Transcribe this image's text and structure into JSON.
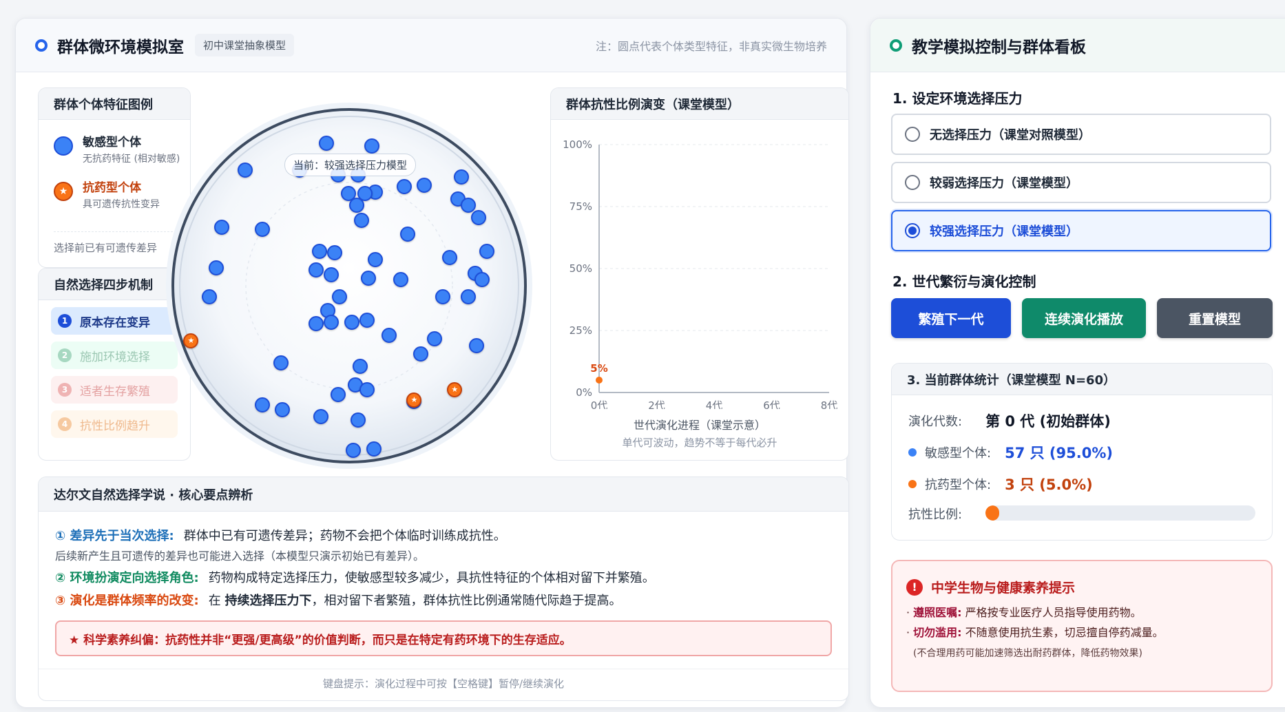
{
  "left": {
    "title": "群体微环境模拟室",
    "tag": "初中课堂抽象模型",
    "note": "注：圆点代表个体类型特征，非真实微生物培养"
  },
  "legend": {
    "header": "群体个体特征图例",
    "sensitive_name": "敏感型个体",
    "sensitive_desc": "无抗药特征 (相对敏感)",
    "resistant_name": "抗药型个体",
    "resistant_desc": "具可遗传抗性变异",
    "footer": "选择前已有可遗传差异"
  },
  "steps": {
    "header": "自然选择四步机制",
    "items": [
      {
        "num": "1",
        "label": "原本存在变异"
      },
      {
        "num": "2",
        "label": "施加环境选择"
      },
      {
        "num": "3",
        "label": "适者生存繁殖"
      },
      {
        "num": "4",
        "label": "抗性比例趋升"
      }
    ]
  },
  "dish": {
    "current_label": "当前：较强选择压力模型"
  },
  "chart_header": "群体抗性比例演变（课堂模型）",
  "chart_data": {
    "type": "line",
    "title": "群体抗性比例演变（课堂模型）",
    "x": [
      0
    ],
    "series": [
      {
        "values": [
          5
        ]
      }
    ],
    "x_ticks": [
      "0代",
      "2代",
      "4代",
      "6代",
      "8代"
    ],
    "x_tick_values": [
      0,
      2,
      4,
      6,
      8
    ],
    "y_ticks": [
      "0%",
      "25%",
      "50%",
      "75%",
      "100%"
    ],
    "y_tick_values": [
      0,
      25,
      50,
      75,
      100
    ],
    "point_label": "5%",
    "xlim": [
      0,
      8
    ],
    "ylim": [
      0,
      100
    ],
    "xlabel": "世代演化进程（课堂示意）",
    "xlabel_sub": "单代可波动，趋势不等于每代必升",
    "grid": true,
    "point_color": "#f97316"
  },
  "analysis": {
    "header": "达尔文自然选择学说 · 核心要点辨析",
    "p1_title": "① 差异先于当次选择:",
    "p1_text": "群体中已有可遗传差异；药物不会把个体临时训练成抗性。",
    "p1_note": "后续新产生且可遗传的差异也可能进入选择（本模型只演示初始已有差异）。",
    "p2_title": "② 环境扮演定向选择角色:",
    "p2_text": "药物构成特定选择压力，使敏感型较多减少，具抗性特征的个体相对留下并繁殖。",
    "p3_title": "③ 演化是群体频率的改变:",
    "p3_pre": "在",
    "p3_bold": "持续选择压力下",
    "p3_post": "，相对留下者繁殖，群体抗性比例通常随代际趋于提高。",
    "warn": "★ 科学素养纠偏：抗药性并非“更强/更高级”的价值判断，而只是在特定有药环境下的生存适应。",
    "kbd_hint": "键盘提示：演化过程中可按【空格键】暂停/继续演化"
  },
  "right": {
    "title": "教学模拟控制与群体看板",
    "section1": "1. 设定环境选择压力",
    "options": [
      "无选择压力（课堂对照模型）",
      "较弱选择压力（课堂模型）",
      "较强选择压力（课堂模型）"
    ],
    "selected_option": "较强选择压力（课堂模型）",
    "section2": "2. 世代繁衍与演化控制",
    "btn_next": "繁殖下一代",
    "btn_play": "连续演化播放",
    "btn_reset": "重置模型",
    "stats_header": "3. 当前群体统计（课堂模型 N=60）",
    "gen_label": "演化代数:",
    "gen_value": "第 0 代 (初始群体)",
    "sens_label": "敏感型个体:",
    "sens_value": "57 只 (95.0%)",
    "res_label": "抗药型个体:",
    "res_value": "3 只 (5.0%)",
    "ratio_label": "抗性比例:",
    "ratio_value": 0.05
  },
  "health": {
    "title": "中学生物与健康素养提示",
    "l1_bold": "遵照医嘱:",
    "l1_text": "严格按专业医疗人员指导使用药物。",
    "l2_bold": "切勿滥用:",
    "l2_text": "不随意使用抗生素，切忌擅自停药减量。",
    "foot": "(不合理用药可能加速筛选出耐药群体，降低药物效果)"
  },
  "colors": {
    "accent_blue": "#1d4ed8",
    "accent_teal": "#0f8a6a",
    "resistant_orange": "#f97316",
    "sensitive_blue": "#3b82f6"
  }
}
